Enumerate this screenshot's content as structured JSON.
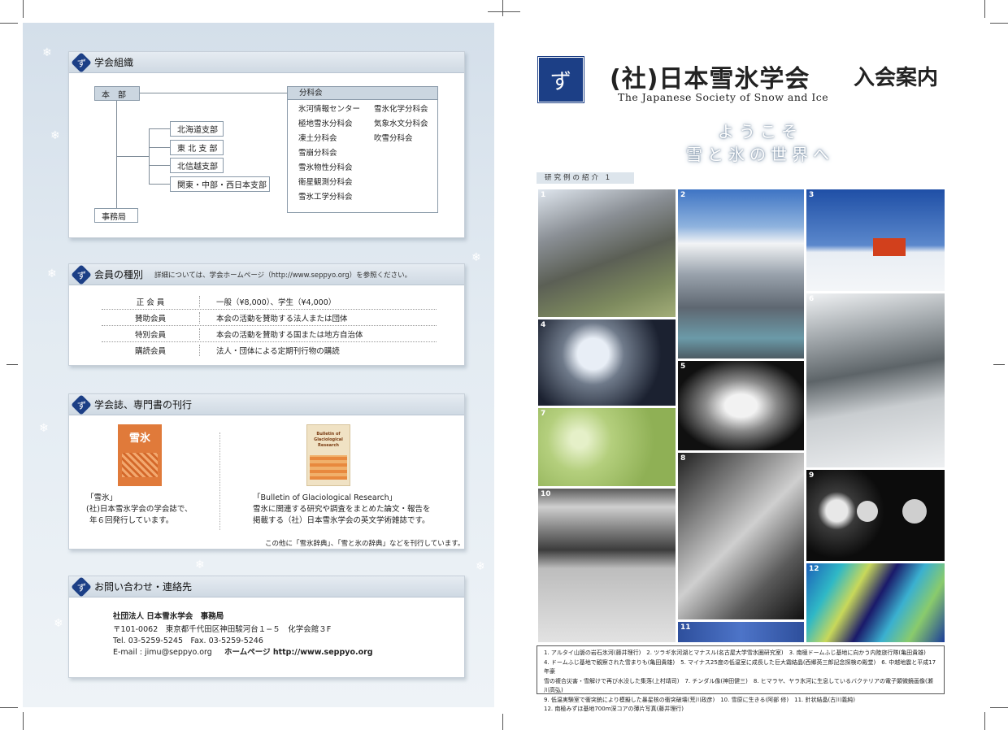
{
  "left": {
    "org": {
      "title": "学会組織",
      "hq": "本　部",
      "office": "事務局",
      "branches": [
        "北海道支部",
        "東 北 支 部",
        "北信越支部",
        "関東・中部・西日本支部"
      ],
      "divisions_label": "分科会",
      "divisions_col1": [
        "氷河情報センター",
        "極地雪氷分科会",
        "凍土分科会",
        "雪崩分科会",
        "雪氷物性分科会",
        "衛星観測分科会",
        "雪氷工学分科会"
      ],
      "divisions_col2": [
        "雪氷化学分科会",
        "気象水文分科会",
        "吹雪分科会"
      ]
    },
    "members": {
      "title": "会員の種別",
      "note": "詳細については、学会ホームページ（http://www.seppyo.org）を参照ください。",
      "rows": [
        {
          "k": "正 会 員",
          "v": "一般（¥8,000）、学生（¥4,000）"
        },
        {
          "k": "賛助会員",
          "v": "本会の活動を賛助する法人または団体"
        },
        {
          "k": "特別会員",
          "v": "本会の活動を賛助する国または地方自治体"
        },
        {
          "k": "購読会員",
          "v": "法人・団体による定期刊行物の購読"
        }
      ]
    },
    "pubs": {
      "title": "学会誌、専門書の刊行",
      "cover1_title": "雪氷",
      "cover2_title": "Bulletin of Glaciological Research",
      "p1_name": "「雪氷」",
      "p1_l1": "(社)日本雪氷学会の学会誌で、",
      "p1_l2": "年６回発行しています。",
      "p2_name": "「Bulletin of Glaciological Research」",
      "p2_l1": "雪氷に関連する研究や調査をまとめた論文・報告を",
      "p2_l2": "掲載する（社）日本雪氷学会の英文学術雑誌です。",
      "other": "この他に「雪氷辞典」、「雪と氷の辞典」などを刊行しています。"
    },
    "contact": {
      "title": "お問い合わせ・連絡先",
      "org": "社団法人 日本雪氷学会　事務局",
      "addr": "〒101-0062　東京都千代田区神田駿河台１−５　化学会館３F",
      "tel": "Tel. 03-5259-5245　Fax. 03-5259-5246",
      "email": "E-mail : jimu@seppyo.org",
      "hp": "ホームページ http://www.seppyo.org"
    }
  },
  "right": {
    "title": "(社)日本雪氷学会",
    "title2": "入会案内",
    "subtitle": "The Japanese Society of Snow and Ice",
    "welcome1": "ようこそ",
    "welcome2": "雪と氷の世界へ",
    "tag": "研究例の紹介 1",
    "photo_nums": [
      "1",
      "2",
      "3",
      "4",
      "5",
      "6",
      "7",
      "8",
      "9",
      "10",
      "11",
      "12"
    ],
    "captions": [
      "1. アルタイ山脈の岩石氷河(藤井理行)　2. ツラギ氷河湖とマナスル(名古屋大学雪氷圏研究室)　3. 南極ドームふじ基地に向かう内陸旅行隊(亀田貴雄)",
      "4. ドームふじ基地で観察された雪まりも(亀田貴雄)　5. マイナス25度の低温室に成長した巨大霜結晶(西郷英三郎記念探検の殿堂)　6. 中越地震と平成17年豪",
      "雪の複合災害・雪解けで再び水没した集落(上村靖司)　7. チンダル像(神田健三)　8. ヒマラヤ、ヤラ氷河に生息しているバクテリアの電子顕微鏡画像(瀬川高弘)",
      "9. 低温実験室で衝突銃により模擬した暴星核の衝突破壊(荒川政彦)　10. 雪原に生きる(阿部 修)　11. 針状結晶(古川義純)",
      "12. 南極みずほ基地700m深コアの薄片写真(藤井理行)"
    ],
    "colors": {
      "navy": "#1c3f86",
      "panel": "#d9e3ec"
    }
  }
}
